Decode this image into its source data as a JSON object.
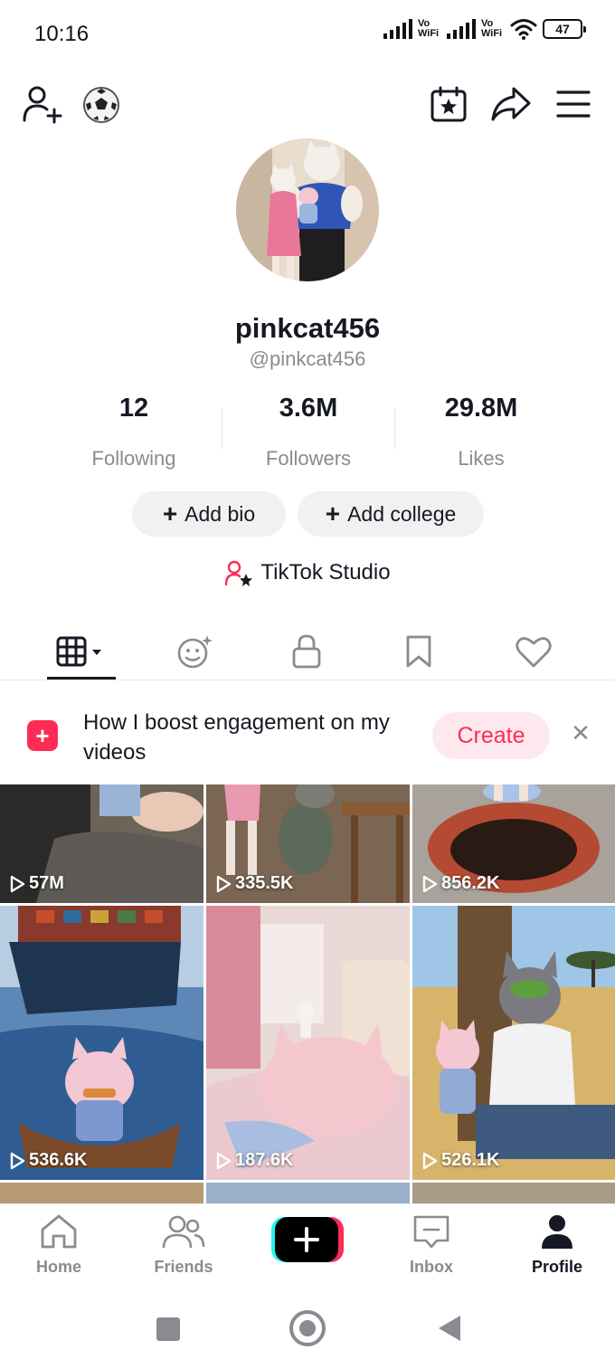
{
  "status_bar": {
    "time": "10:16",
    "network_label_1": "Vo WiFi",
    "network_label_2": "Vo WiFi",
    "battery": "47"
  },
  "header": {
    "left_icons": [
      "add-friend-icon",
      "soccer-ball-icon"
    ],
    "right_icons": [
      "calendar-star-icon",
      "share-icon",
      "menu-icon"
    ]
  },
  "profile": {
    "display_name": "pinkcat456",
    "handle": "@pinkcat456",
    "stats": [
      {
        "value": "12",
        "label": "Following"
      },
      {
        "value": "3.6M",
        "label": "Followers"
      },
      {
        "value": "29.8M",
        "label": "Likes"
      }
    ],
    "add_bio_label": "Add bio",
    "add_college_label": "Add college",
    "studio_label": "TikTok Studio"
  },
  "tabs": [
    {
      "icon": "grid-icon",
      "active": true
    },
    {
      "icon": "reposts-icon",
      "active": false
    },
    {
      "icon": "lock-icon",
      "active": false
    },
    {
      "icon": "bookmark-icon",
      "active": false
    },
    {
      "icon": "heart-icon",
      "active": false
    }
  ],
  "promo": {
    "text": "How I boost engagement on my videos",
    "button": "Create"
  },
  "videos": [
    {
      "views": "57M"
    },
    {
      "views": "335.5K"
    },
    {
      "views": "856.2K"
    },
    {
      "views": "536.6K"
    },
    {
      "views": "187.6K"
    },
    {
      "views": "526.1K"
    }
  ],
  "bottom_nav": [
    {
      "label": "Home",
      "icon": "home-icon"
    },
    {
      "label": "Friends",
      "icon": "friends-icon"
    },
    {
      "label": "",
      "icon": "create-icon"
    },
    {
      "label": "Inbox",
      "icon": "inbox-icon"
    },
    {
      "label": "Profile",
      "icon": "profile-icon"
    }
  ],
  "colors": {
    "accent": "#fe2c55",
    "text_primary": "#161823",
    "text_secondary": "#8a8b91"
  }
}
